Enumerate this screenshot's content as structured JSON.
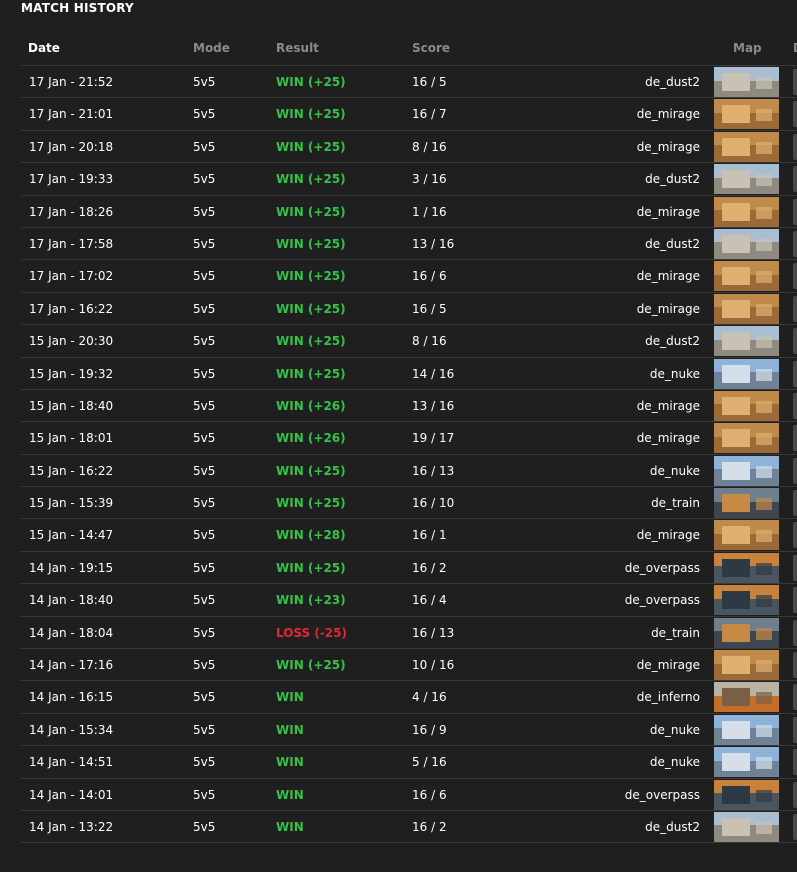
{
  "title": "MATCH HISTORY",
  "headers": {
    "date": "Date",
    "mode": "Mode",
    "result": "Result",
    "score": "Score",
    "map": "Map",
    "extra": "D"
  },
  "map_colors": {
    "de_dust2": {
      "sky": "#a9bed0",
      "mid": "#c9c2b4",
      "ground": "#8f8a80"
    },
    "de_mirage": {
      "sky": "#c08a4a",
      "mid": "#e0b070",
      "ground": "#9a6a38"
    },
    "de_nuke": {
      "sky": "#8fb2d8",
      "mid": "#d4dfe9",
      "ground": "#6f8296"
    },
    "de_train": {
      "sky": "#6f7f8e",
      "mid": "#c58a46",
      "ground": "#3f4650"
    },
    "de_overpass": {
      "sky": "#c9823c",
      "mid": "#2d3a44",
      "ground": "#4a5560"
    },
    "de_inferno": {
      "sky": "#b9b3a4",
      "mid": "#7a5f45",
      "ground": "#c56f2c"
    }
  },
  "rows": [
    {
      "date": "17 Jan - 21:52",
      "mode": "5v5",
      "result": "WIN (+25)",
      "outcome": "win",
      "score": "16 / 5",
      "map": "de_dust2"
    },
    {
      "date": "17 Jan - 21:01",
      "mode": "5v5",
      "result": "WIN (+25)",
      "outcome": "win",
      "score": "16 / 7",
      "map": "de_mirage"
    },
    {
      "date": "17 Jan - 20:18",
      "mode": "5v5",
      "result": "WIN (+25)",
      "outcome": "win",
      "score": "8 / 16",
      "map": "de_mirage"
    },
    {
      "date": "17 Jan - 19:33",
      "mode": "5v5",
      "result": "WIN (+25)",
      "outcome": "win",
      "score": "3 / 16",
      "map": "de_dust2"
    },
    {
      "date": "17 Jan - 18:26",
      "mode": "5v5",
      "result": "WIN (+25)",
      "outcome": "win",
      "score": "1 / 16",
      "map": "de_mirage"
    },
    {
      "date": "17 Jan - 17:58",
      "mode": "5v5",
      "result": "WIN (+25)",
      "outcome": "win",
      "score": "13 / 16",
      "map": "de_dust2"
    },
    {
      "date": "17 Jan - 17:02",
      "mode": "5v5",
      "result": "WIN (+25)",
      "outcome": "win",
      "score": "16 / 6",
      "map": "de_mirage"
    },
    {
      "date": "17 Jan - 16:22",
      "mode": "5v5",
      "result": "WIN (+25)",
      "outcome": "win",
      "score": "16 / 5",
      "map": "de_mirage"
    },
    {
      "date": "15 Jan - 20:30",
      "mode": "5v5",
      "result": "WIN (+25)",
      "outcome": "win",
      "score": "8 / 16",
      "map": "de_dust2"
    },
    {
      "date": "15 Jan - 19:32",
      "mode": "5v5",
      "result": "WIN (+25)",
      "outcome": "win",
      "score": "14 / 16",
      "map": "de_nuke"
    },
    {
      "date": "15 Jan - 18:40",
      "mode": "5v5",
      "result": "WIN (+26)",
      "outcome": "win",
      "score": "13 / 16",
      "map": "de_mirage"
    },
    {
      "date": "15 Jan - 18:01",
      "mode": "5v5",
      "result": "WIN (+26)",
      "outcome": "win",
      "score": "19 / 17",
      "map": "de_mirage"
    },
    {
      "date": "15 Jan - 16:22",
      "mode": "5v5",
      "result": "WIN (+25)",
      "outcome": "win",
      "score": "16 / 13",
      "map": "de_nuke"
    },
    {
      "date": "15 Jan - 15:39",
      "mode": "5v5",
      "result": "WIN (+25)",
      "outcome": "win",
      "score": "16 / 10",
      "map": "de_train"
    },
    {
      "date": "15 Jan - 14:47",
      "mode": "5v5",
      "result": "WIN (+28)",
      "outcome": "win",
      "score": "16 / 1",
      "map": "de_mirage"
    },
    {
      "date": "14 Jan - 19:15",
      "mode": "5v5",
      "result": "WIN (+25)",
      "outcome": "win",
      "score": "16 / 2",
      "map": "de_overpass"
    },
    {
      "date": "14 Jan - 18:40",
      "mode": "5v5",
      "result": "WIN (+23)",
      "outcome": "win",
      "score": "16 / 4",
      "map": "de_overpass"
    },
    {
      "date": "14 Jan - 18:04",
      "mode": "5v5",
      "result": "LOSS (-25)",
      "outcome": "loss",
      "score": "16 / 13",
      "map": "de_train"
    },
    {
      "date": "14 Jan - 17:16",
      "mode": "5v5",
      "result": "WIN (+25)",
      "outcome": "win",
      "score": "10 / 16",
      "map": "de_mirage"
    },
    {
      "date": "14 Jan - 16:15",
      "mode": "5v5",
      "result": "WIN",
      "outcome": "win",
      "score": "4 / 16",
      "map": "de_inferno"
    },
    {
      "date": "14 Jan - 15:34",
      "mode": "5v5",
      "result": "WIN",
      "outcome": "win",
      "score": "16 / 9",
      "map": "de_nuke"
    },
    {
      "date": "14 Jan - 14:51",
      "mode": "5v5",
      "result": "WIN",
      "outcome": "win",
      "score": "5 / 16",
      "map": "de_nuke"
    },
    {
      "date": "14 Jan - 14:01",
      "mode": "5v5",
      "result": "WIN",
      "outcome": "win",
      "score": "16 / 6",
      "map": "de_overpass"
    },
    {
      "date": "14 Jan - 13:22",
      "mode": "5v5",
      "result": "WIN",
      "outcome": "win",
      "score": "16 / 2",
      "map": "de_dust2"
    }
  ]
}
